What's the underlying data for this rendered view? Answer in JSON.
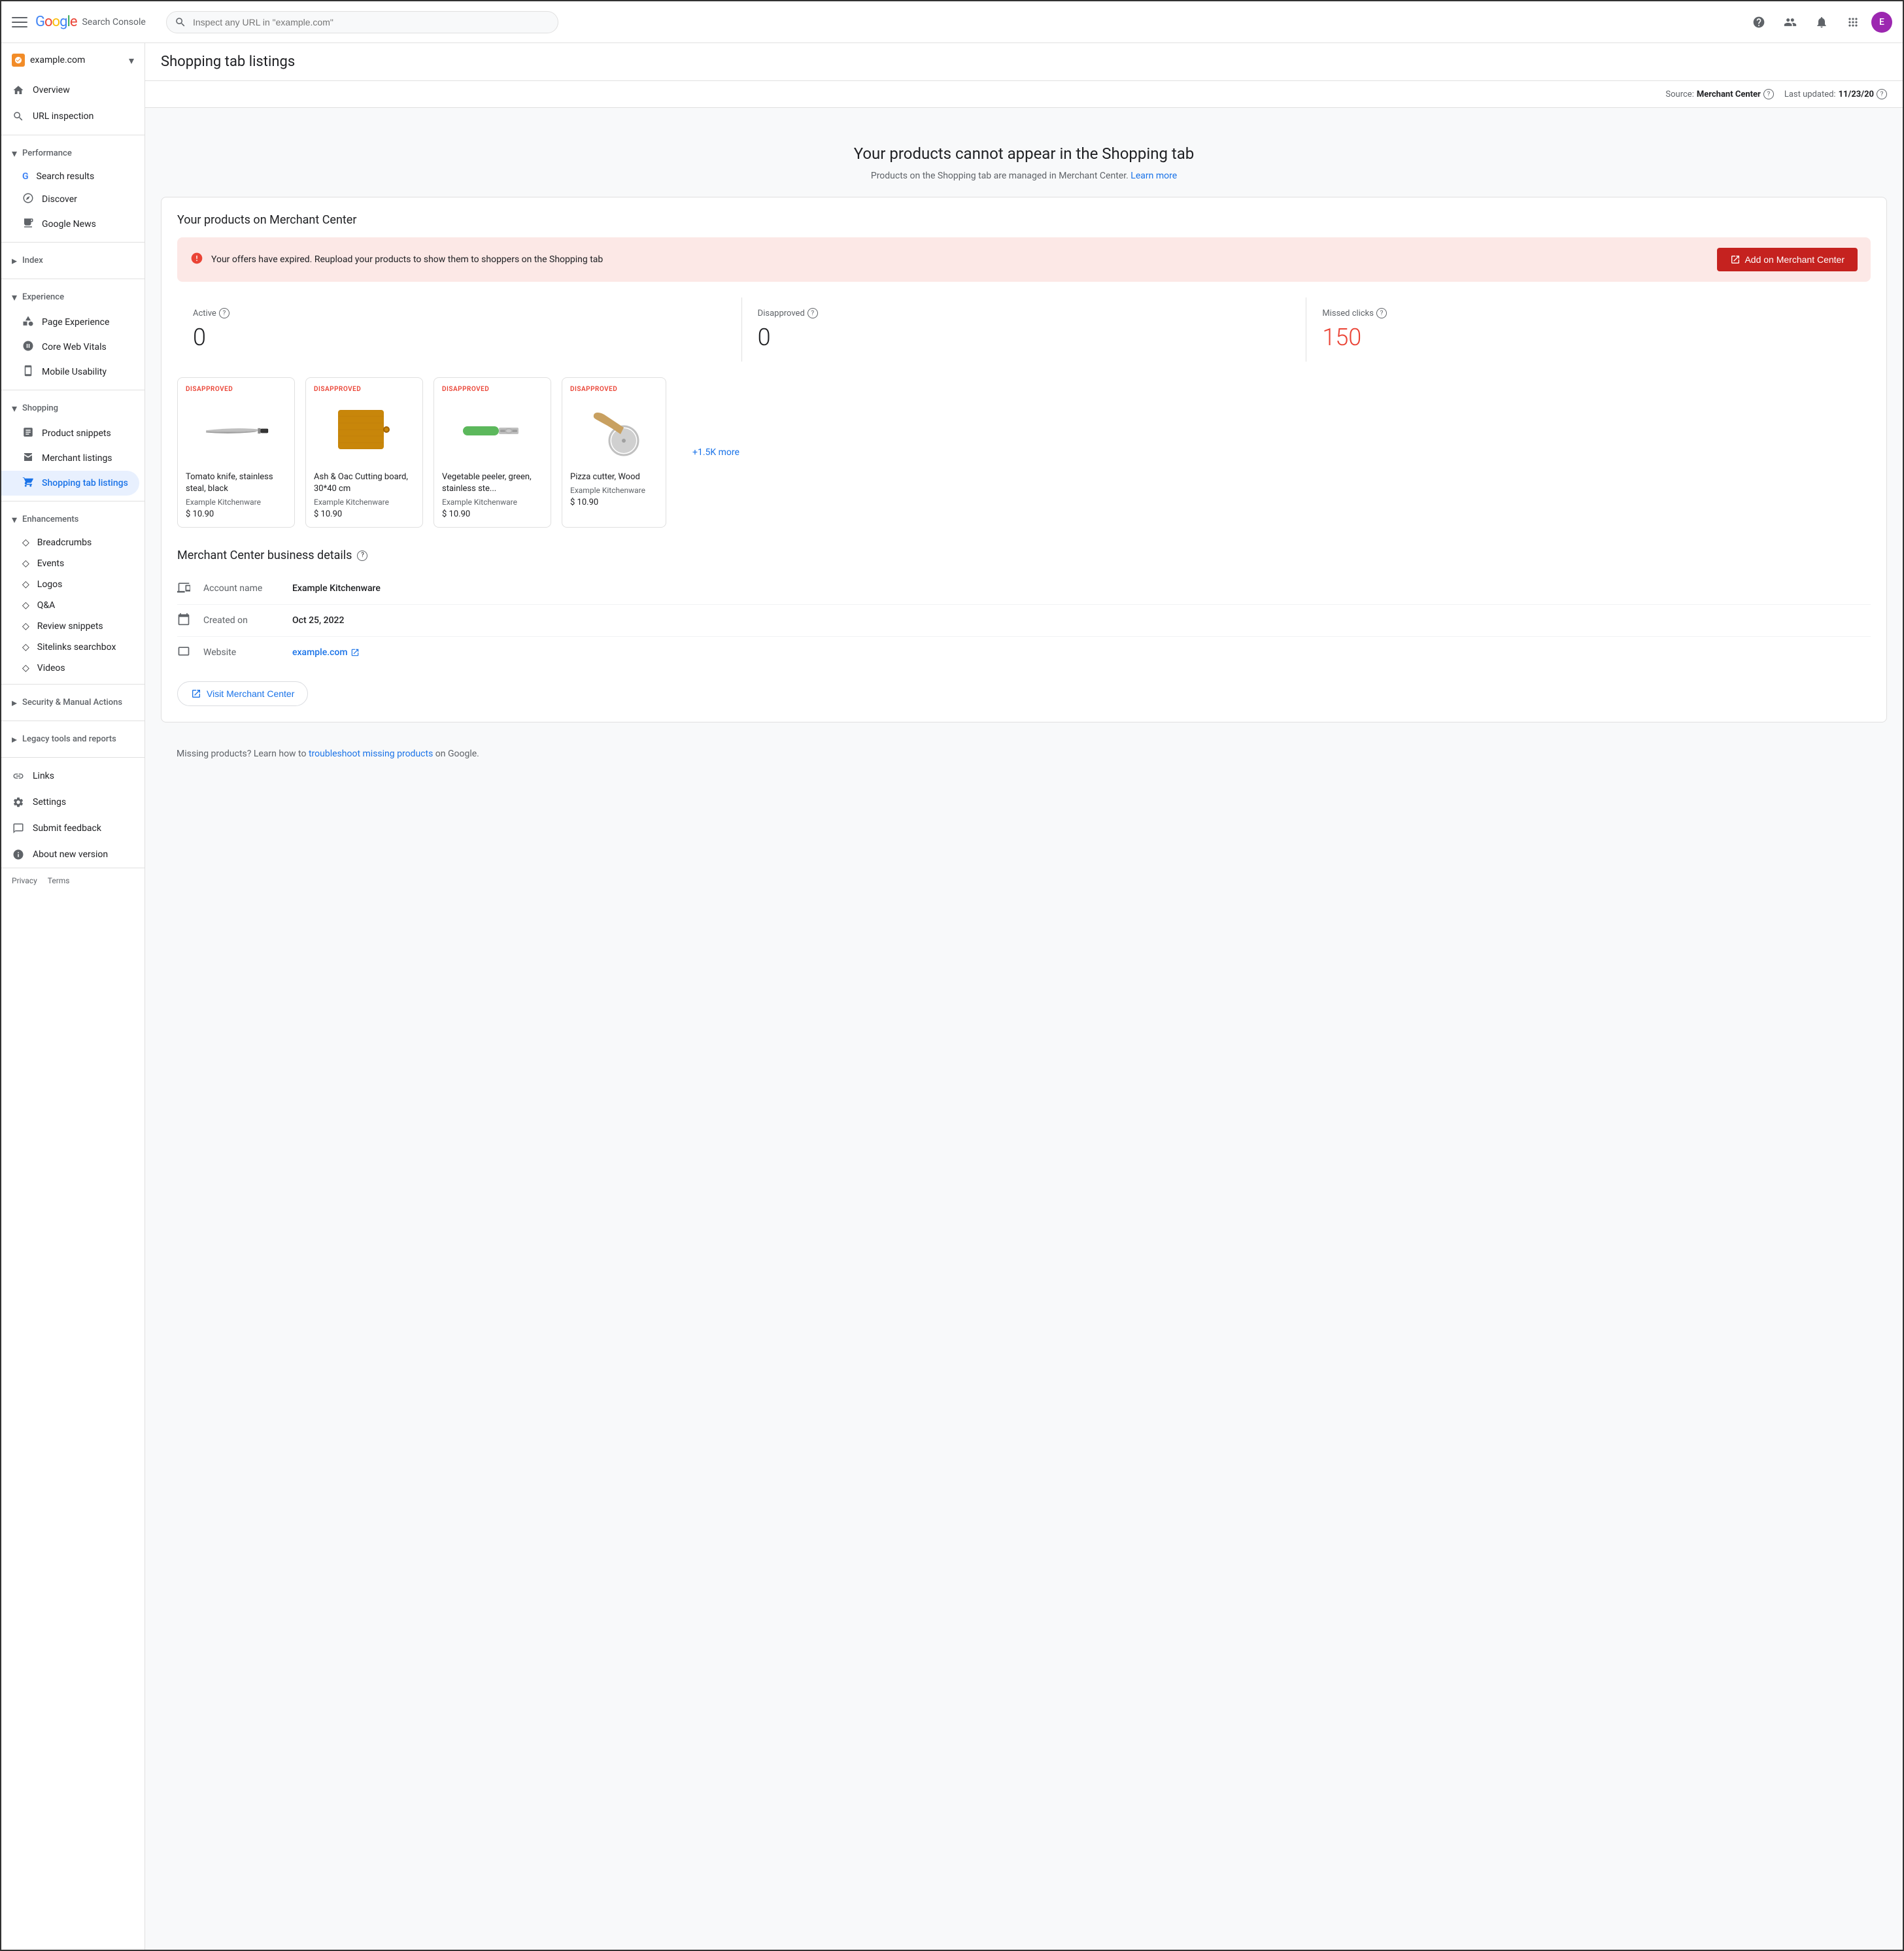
{
  "app": {
    "logo": "Google Search Console",
    "logo_parts": [
      "G",
      "o",
      "o",
      "g",
      "l",
      "e"
    ],
    "search_placeholder": "Inspect any URL in \"example.com\"",
    "site": "example.com",
    "user_initial": "E"
  },
  "topbar": {
    "help_label": "Help",
    "account_label": "Account",
    "notifications_label": "Notifications",
    "apps_label": "Google apps"
  },
  "sidebar": {
    "overview_label": "Overview",
    "url_inspection_label": "URL inspection",
    "performance_header": "Performance",
    "performance_collapsed": false,
    "search_results_label": "Search results",
    "discover_label": "Discover",
    "google_news_label": "Google News",
    "index_header": "Index",
    "experience_header": "Experience",
    "page_experience_label": "Page Experience",
    "core_web_vitals_label": "Core Web Vitals",
    "mobile_usability_label": "Mobile Usability",
    "shopping_header": "Shopping",
    "product_snippets_label": "Product snippets",
    "merchant_listings_label": "Merchant listings",
    "shopping_tab_listings_label": "Shopping tab listings",
    "enhancements_header": "Enhancements",
    "breadcrumbs_label": "Breadcrumbs",
    "events_label": "Events",
    "logos_label": "Logos",
    "qa_label": "Q&A",
    "review_snippets_label": "Review snippets",
    "sitelinks_searchbox_label": "Sitelinks searchbox",
    "videos_label": "Videos",
    "security_header": "Security & Manual Actions",
    "legacy_header": "Legacy tools and reports",
    "links_label": "Links",
    "settings_label": "Settings",
    "submit_feedback_label": "Submit feedback",
    "about_new_version_label": "About new version",
    "privacy_label": "Privacy",
    "terms_label": "Terms"
  },
  "page": {
    "title": "Shopping tab listings",
    "source_label": "Source:",
    "source_value": "Merchant Center",
    "last_updated_label": "Last updated:",
    "last_updated_value": "11/23/20"
  },
  "hero": {
    "title": "Your products cannot appear in the Shopping tab",
    "description": "Products on the Shopping tab are managed in Merchant Center.",
    "learn_more_label": "Learn more"
  },
  "merchant_card": {
    "title": "Your products on Merchant Center",
    "alert_text": "Your offers have expired. Reupload your products to show them to shoppers on the Shopping tab",
    "add_button_label": "Add on Merchant Center",
    "active_label": "Active",
    "disapproved_label": "Disapproved",
    "missed_clicks_label": "Missed clicks",
    "active_value": "0",
    "disapproved_value": "0",
    "missed_clicks_value": "150",
    "more_label": "+1.5K more"
  },
  "products": [
    {
      "badge": "DISAPPROVED",
      "name": "Tomato knife, stainless steal, black",
      "seller": "Example Kitchenware",
      "price": "$ 10.90",
      "img_type": "knife"
    },
    {
      "badge": "DISAPPROVED",
      "name": "Ash & Oac Cutting board, 30*40 cm",
      "seller": "Example Kitchenware",
      "price": "$ 10.90",
      "img_type": "cutting_board"
    },
    {
      "badge": "DISAPPROVED",
      "name": "Vegetable peeler, green, stainless ste...",
      "seller": "Example Kitchenware",
      "price": "$ 10.90",
      "img_type": "peeler"
    },
    {
      "badge": "DISAPPROVED",
      "name": "Pizza cutter, Wood",
      "seller": "Example Kitchenware",
      "price": "$ 10.90",
      "img_type": "pizza_cutter"
    }
  ],
  "business_details": {
    "title": "Merchant Center business details",
    "account_name_label": "Account name",
    "account_name_value": "Example Kitchenware",
    "created_on_label": "Created on",
    "created_on_value": "Oct 25, 2022",
    "website_label": "Website",
    "website_value": "example.com",
    "visit_button_label": "Visit Merchant Center"
  },
  "footer": {
    "missing_products_text": "Missing products? Learn how to",
    "troubleshoot_label": "troubleshoot missing products",
    "on_google_text": "on Google."
  }
}
